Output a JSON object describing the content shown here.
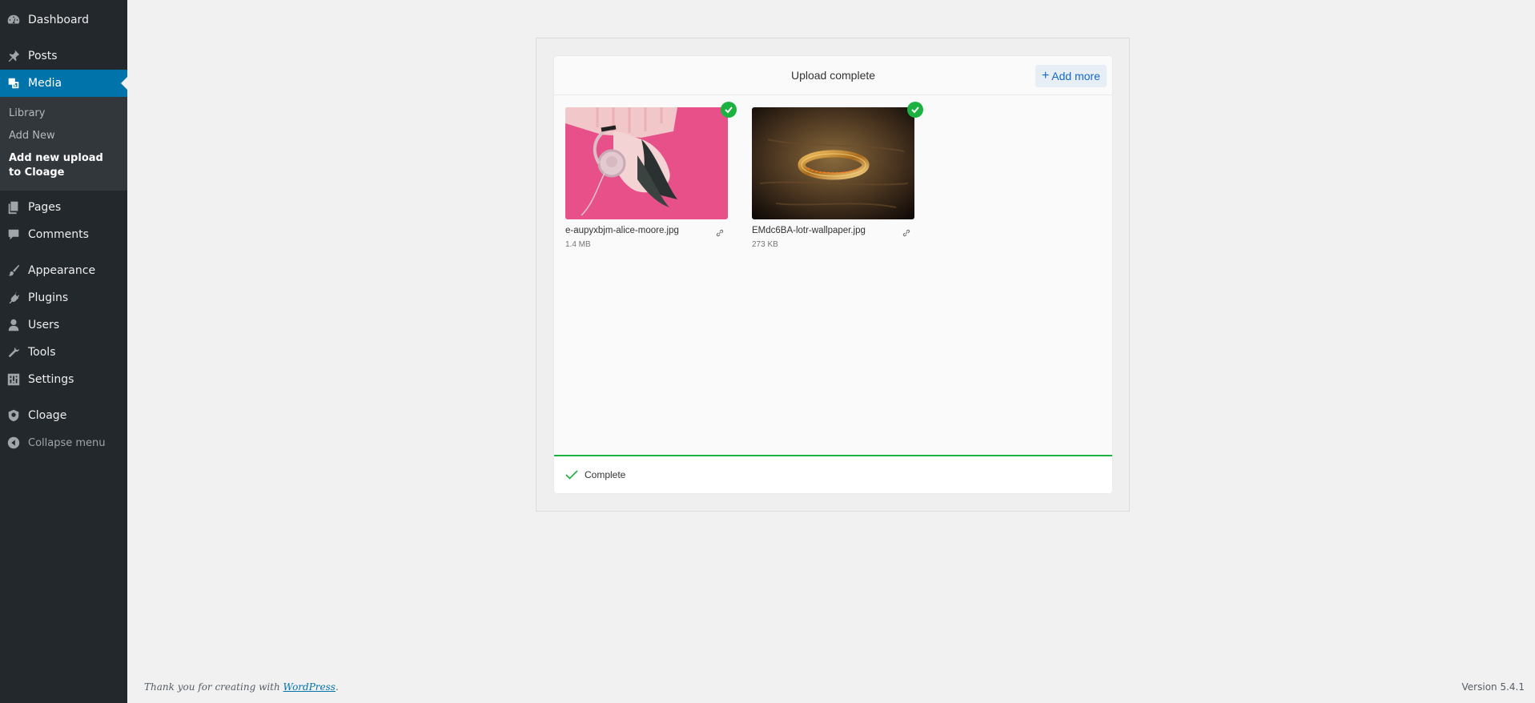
{
  "sidebar": {
    "items": [
      {
        "label": "Dashboard",
        "icon": "dashboard-icon"
      },
      {
        "label": "Posts",
        "icon": "pin-icon"
      },
      {
        "label": "Media",
        "icon": "media-icon",
        "active": true
      },
      {
        "label": "Pages",
        "icon": "pages-icon"
      },
      {
        "label": "Comments",
        "icon": "comment-icon"
      },
      {
        "label": "Appearance",
        "icon": "brush-icon"
      },
      {
        "label": "Plugins",
        "icon": "plug-icon"
      },
      {
        "label": "Users",
        "icon": "user-icon"
      },
      {
        "label": "Tools",
        "icon": "wrench-icon"
      },
      {
        "label": "Settings",
        "icon": "settings-icon"
      },
      {
        "label": "Cloage",
        "icon": "shield-icon"
      },
      {
        "label": "Collapse menu",
        "icon": "collapse-icon"
      }
    ],
    "submenu": [
      {
        "label": "Library"
      },
      {
        "label": "Add New"
      },
      {
        "label": "Add new upload to Cloage",
        "current": true
      }
    ]
  },
  "uploader": {
    "title": "Upload complete",
    "add_more_label": "Add more",
    "files": [
      {
        "name": "e-aupyxbjm-alice-moore.jpg",
        "size": "1.4 MB"
      },
      {
        "name": "EMdc6BA-lotr-wallpaper.jpg",
        "size": "273 KB"
      }
    ],
    "status_text": "Complete"
  },
  "footer": {
    "thanks_prefix": "Thank you for creating with ",
    "wordpress_link": "WordPress",
    "thanks_suffix": ".",
    "version": "Version 5.4.1"
  },
  "colors": {
    "sidebar_bg": "#23282d",
    "active_bg": "#0073aa",
    "success": "#1bb240",
    "link": "#1269cf"
  }
}
